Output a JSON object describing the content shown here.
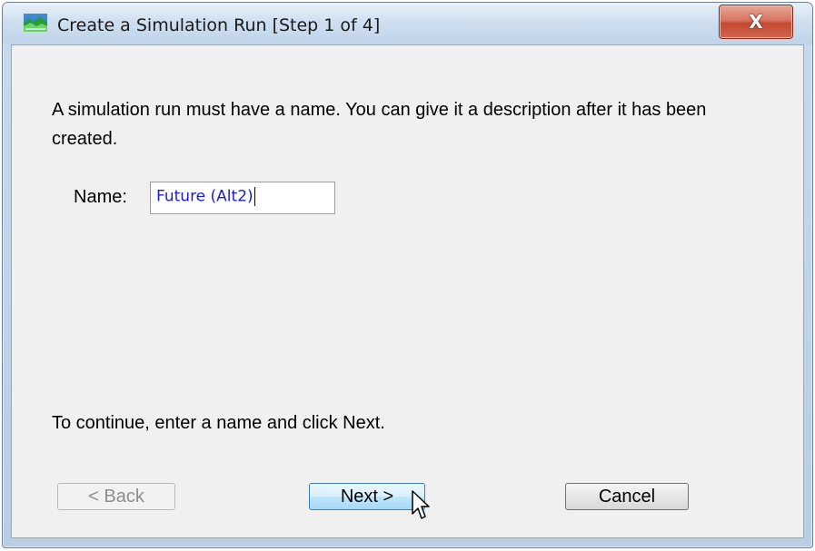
{
  "window": {
    "title": "Create a Simulation Run [Step 1 of 4]",
    "close_label": "X"
  },
  "dialog": {
    "description": "A simulation run must have a name. You can give it a description after it has been created.",
    "name_label": "Name:",
    "name_value": "Future (Alt2)",
    "hint": "To continue, enter a name and click Next."
  },
  "buttons": {
    "back": "< Back",
    "next": "Next >",
    "cancel": "Cancel"
  },
  "icons": {
    "app": "hec-hms-landscape-icon",
    "cursor": "mouse-pointer-icon"
  },
  "colors": {
    "input_text": "#1c1ccf",
    "close_button": "#c44a33",
    "next_button": "#bee6fd"
  }
}
